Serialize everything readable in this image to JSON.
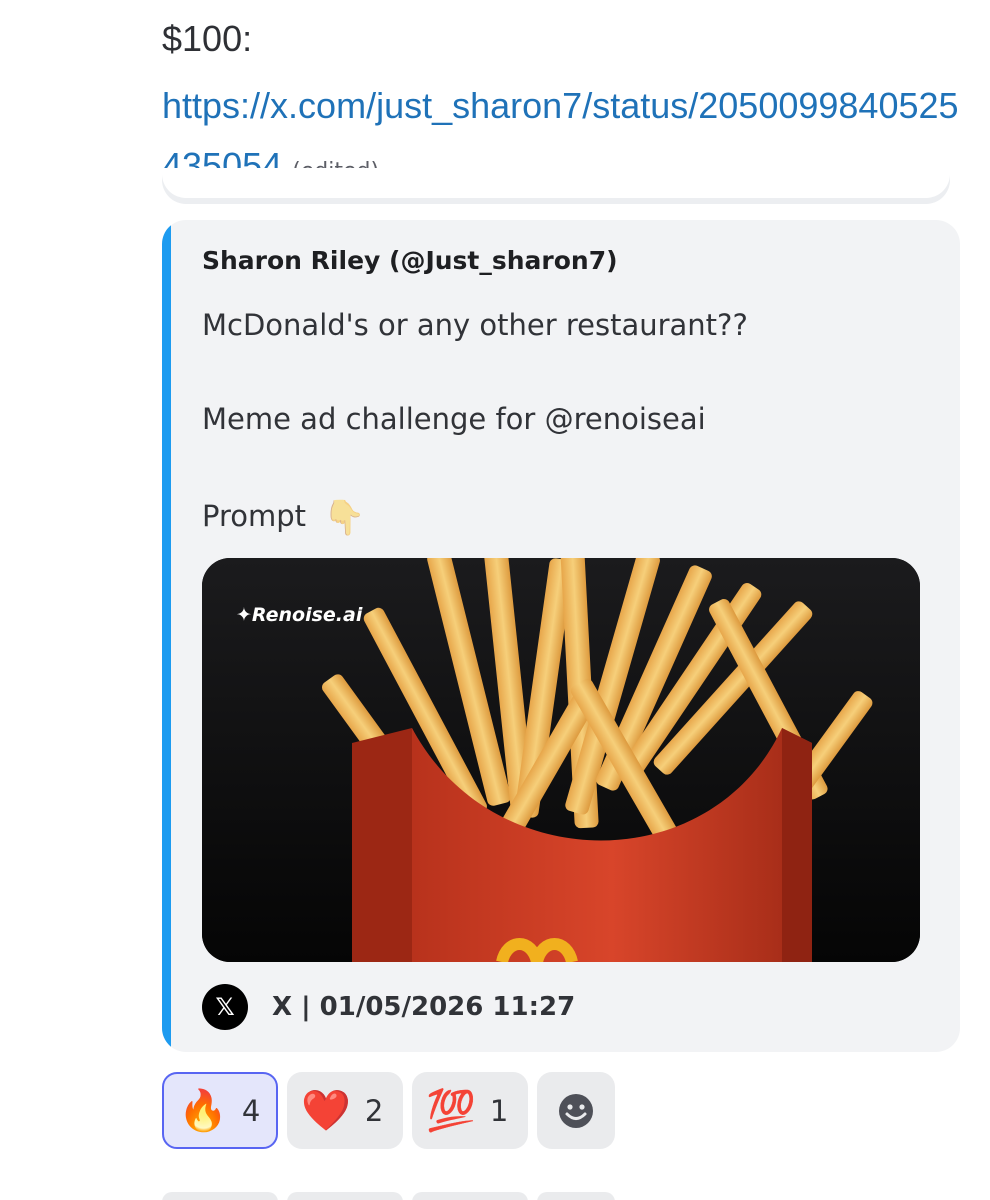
{
  "message": {
    "prefix": "$100:",
    "link": "https://x.com/just_sharon7/status/2050099840525435054",
    "edited_label": "(edited)"
  },
  "embed": {
    "author": "Sharon Riley (@Just_sharon7)",
    "lines": [
      "McDonald's or any other restaurant??",
      "Meme ad challenge for @renoiseai",
      "Prompt"
    ],
    "prompt_emoji": "👇",
    "image_watermark": "Renoise.ai",
    "footer": {
      "provider_icon": "x-logo-icon",
      "text": "X | 01/05/2026 11:27"
    },
    "accent_color": "#1d9bf0"
  },
  "reactions": [
    {
      "emoji": "🔥",
      "count": "4",
      "active": true
    },
    {
      "emoji": "❤️",
      "count": "2",
      "active": false
    },
    {
      "emoji": "💯",
      "count": "1",
      "active": false
    }
  ],
  "add_reaction_icon": "smiley-add-reaction-icon"
}
